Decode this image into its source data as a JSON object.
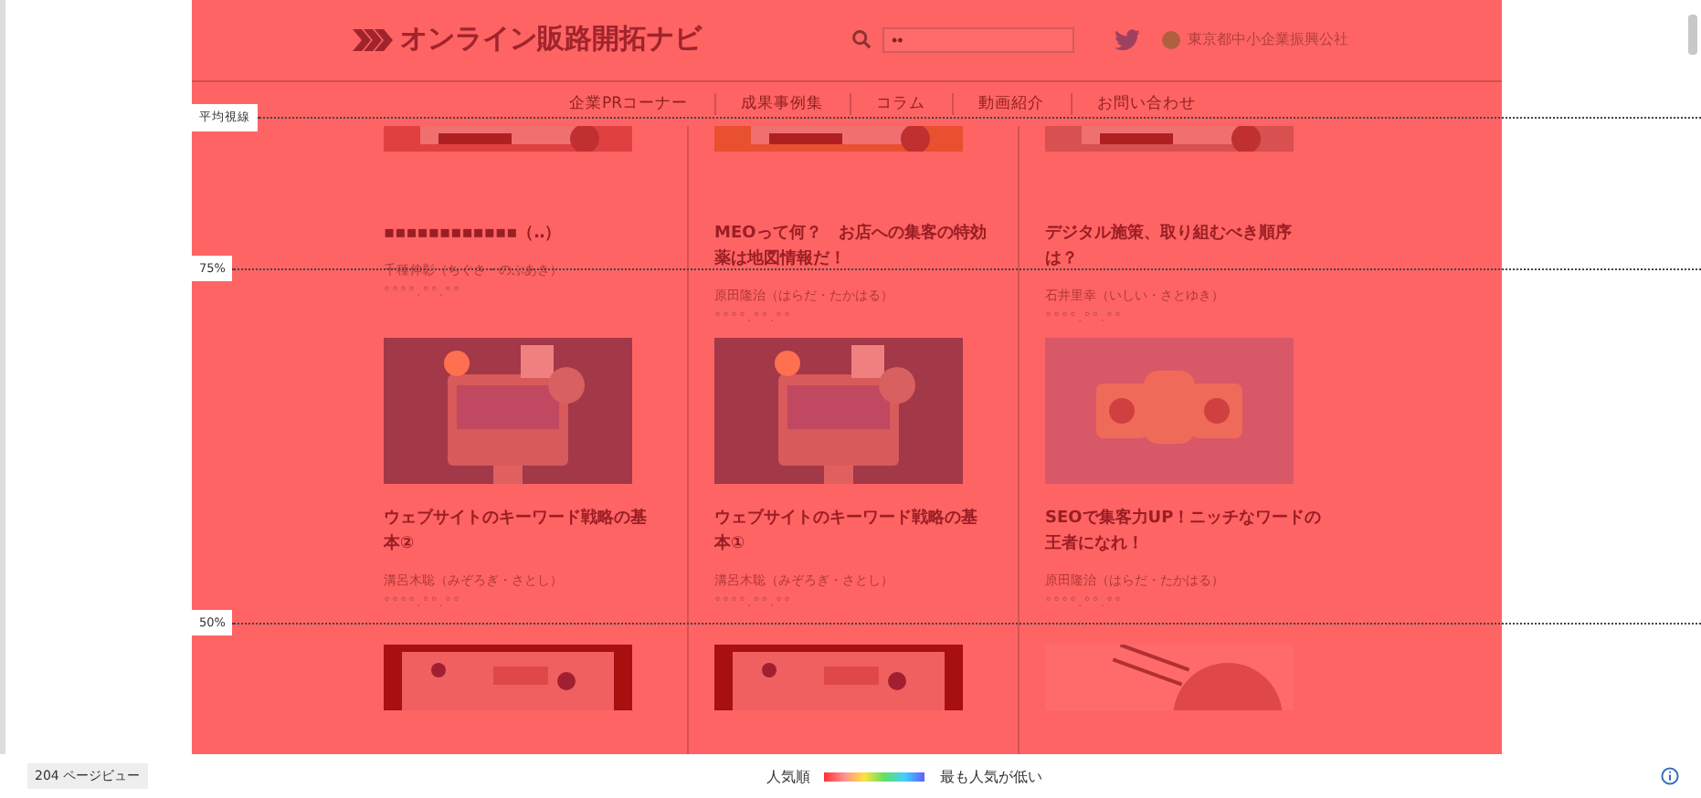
{
  "header": {
    "logo": "オンライン販路開拓ナビ",
    "search": {
      "value": "••"
    },
    "organization": "東京都中小企業振興公社"
  },
  "nav": [
    {
      "label": "企業PRコーナー"
    },
    {
      "label": "成果事例集"
    },
    {
      "label": "コラム"
    },
    {
      "label": "動画紹介"
    },
    {
      "label": "お問い合わせ"
    }
  ],
  "articles": [
    {
      "kind": "picture",
      "title": "▪▪▪▪▪▪▪▪▪▪▪▪（‥）",
      "author": "千種伸彰（ちぐさ・のぶあき）",
      "date": "°°°°.°°.°°"
    },
    {
      "kind": "picture",
      "title": "MEOって何？　お店への集客の特効薬は地図情報だ！",
      "author": "原田隆治（はらだ・たかはる）",
      "date": "°°°°.°°.°°"
    },
    {
      "kind": "picture",
      "title": "デジタル施策、取り組むべき順序は？",
      "author": "石井里幸（いしい・さとゆき）",
      "date": "°°°°.°°.°°"
    },
    {
      "kind": "picture",
      "title": "ウェブサイトのキーワード戦略の基本②",
      "author": "溝呂木聡（みぞろぎ・さとし）",
      "date": "°°°°.°°.°°"
    },
    {
      "kind": "picture",
      "title": "ウェブサイトのキーワード戦略の基本①",
      "author": "溝呂木聡（みぞろぎ・さとし）",
      "date": "°°°°.°°.°°"
    },
    {
      "kind": "picture",
      "title": "SEOで集客力UP！ニッチなワードの王者になれ！",
      "author": "原田隆治（はらだ・たかはる）",
      "date": "°°°°.°°.°°"
    },
    {
      "kind": "picture"
    },
    {
      "kind": "picture"
    },
    {
      "kind": "picture"
    }
  ],
  "heatmap_markers": [
    {
      "label": "平均視線"
    },
    {
      "label": "75%"
    },
    {
      "label": "50%"
    }
  ],
  "footer": {
    "page_views": "204 ページビュー",
    "legend_start": "人気順",
    "legend_end": "最も人気が低い"
  }
}
